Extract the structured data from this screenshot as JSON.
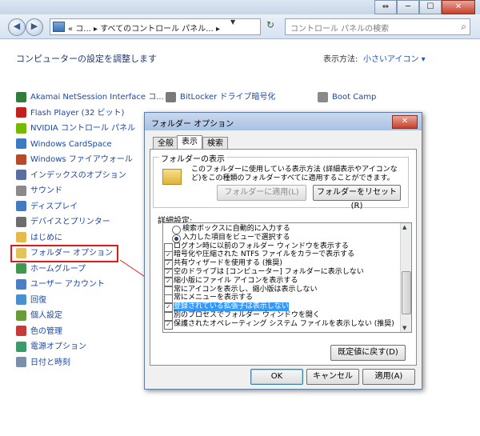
{
  "window": {
    "buttons": [
      "⇔",
      "─",
      "☐",
      "✕"
    ]
  },
  "nav": {
    "back_glyph": "◀",
    "forward_glyph": "▶",
    "address": "« コ... ▸ すべてのコントロール パネル... ▸",
    "address_dropdown": "▼",
    "refresh_glyph": "↻",
    "search_placeholder": "コントロール パネルの検索",
    "search_icon": "⌕"
  },
  "main": {
    "heading": "コンピューターの設定を調整します",
    "view_label": "表示方法:",
    "view_value": "小さいアイコン ▾"
  },
  "items": [
    {
      "label": "Akamai NetSession Interface コ...",
      "icon": "#2f7d3a"
    },
    {
      "label": "Flash Player (32 ビット)",
      "icon": "#c0211d"
    },
    {
      "label": "NVIDIA コントロール パネル",
      "icon": "#76b900"
    },
    {
      "label": "Windows CardSpace",
      "icon": "#3a7bc8"
    },
    {
      "label": "Windows ファイアウォール",
      "icon": "#b84a2a"
    },
    {
      "label": "インデックスのオプション",
      "icon": "#5a6fa0"
    },
    {
      "label": "サウンド",
      "icon": "#8a8a8a"
    },
    {
      "label": "ディスプレイ",
      "icon": "#3f7cc2"
    },
    {
      "label": "デバイスとプリンター",
      "icon": "#6d6d6d"
    },
    {
      "label": "はじめに",
      "icon": "#e7b94b"
    },
    {
      "label": "フォルダー オプション",
      "icon": "#e2c25a"
    },
    {
      "label": "ホームグループ",
      "icon": "#3c9a4a"
    },
    {
      "label": "ユーザー アカウント",
      "icon": "#4a7fc6"
    },
    {
      "label": "回復",
      "icon": "#4a8fd0"
    },
    {
      "label": "個人設定",
      "icon": "#6a9a3a"
    },
    {
      "label": "色の管理",
      "icon": "#c83a3a"
    },
    {
      "label": "電源オプション",
      "icon": "#3a9a6a"
    },
    {
      "label": "日付と時刻",
      "icon": "#7a8fa8"
    }
  ],
  "items_col2": [
    {
      "label": "BitLocker ドライブ暗号化",
      "icon": "#7a7a7a"
    }
  ],
  "items_col3": [
    {
      "label": "Boot Camp",
      "icon": "#8a8a8a"
    }
  ],
  "dialog": {
    "title": "フォルダー オプション",
    "close": "✕",
    "tabs": [
      "全般",
      "表示",
      "検索"
    ],
    "group_label": "フォルダーの表示",
    "group_text": "このフォルダーに使用している表示方法 (詳細表示やアイコンなど)をこの種類のフォルダーすべてに適用することができます。",
    "apply_folders": "フォルダーに適用(L)",
    "reset_folders": "フォルダーをリセット(R)",
    "advanced_label": "詳細設定:",
    "rows": [
      {
        "type": "radio",
        "checked": false,
        "text": "検索ボックスに自動的に入力する"
      },
      {
        "type": "radio",
        "checked": true,
        "text": "入力した項目をビューで選択する"
      },
      {
        "type": "check",
        "checked": false,
        "text": "ログオン時に以前のフォルダー ウィンドウを表示する"
      },
      {
        "type": "check",
        "checked": true,
        "text": "暗号化や圧縮された NTFS ファイルをカラーで表示する"
      },
      {
        "type": "check",
        "checked": true,
        "text": "共有ウィザードを使用する (推奨)"
      },
      {
        "type": "check",
        "checked": true,
        "text": "空のドライブは [コンピューター] フォルダーに表示しない"
      },
      {
        "type": "check",
        "checked": true,
        "text": "縮小版にファイル アイコンを表示する"
      },
      {
        "type": "check",
        "checked": false,
        "text": "常にアイコンを表示し、縮小版は表示しない"
      },
      {
        "type": "check",
        "checked": false,
        "text": "常にメニューを表示する"
      },
      {
        "type": "check",
        "checked": true,
        "text": "登録されている拡張子は表示しない",
        "selected": true
      },
      {
        "type": "check",
        "checked": false,
        "text": "別のプロセスでフォルダー ウィンドウを開く"
      },
      {
        "type": "check",
        "checked": true,
        "text": "保護されたオペレーティング システム ファイルを表示しない (推奨)"
      }
    ],
    "restore": "既定値に戻す(D)",
    "ok": "OK",
    "cancel": "キャンセル",
    "apply": "適用(A)"
  }
}
